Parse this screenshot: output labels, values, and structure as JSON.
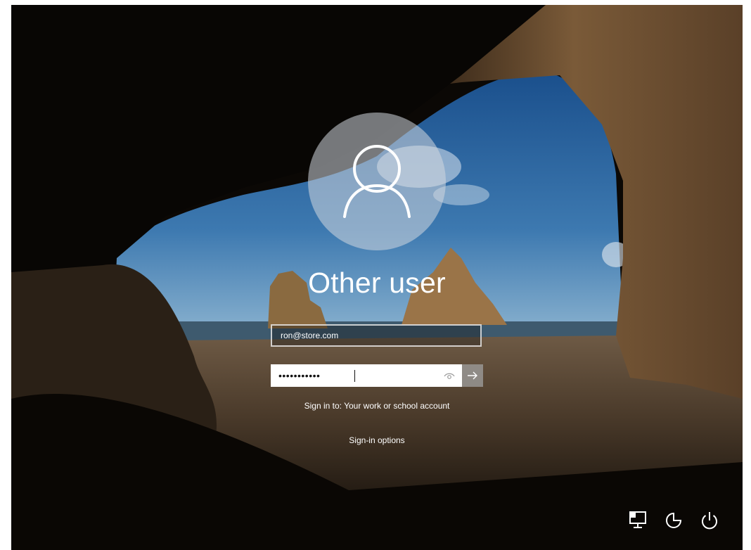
{
  "login": {
    "user_name": "Other user",
    "email_value": "ron@store.com",
    "password_mask": "•••••••••••",
    "sign_in_to": "Sign in to: Your work or school account",
    "sign_in_options": "Sign-in options"
  },
  "icons": {
    "avatar": "person-icon",
    "reveal": "eye-icon",
    "submit": "arrow-right-icon",
    "network": "network-icon",
    "accessibility": "ease-of-access-icon",
    "power": "power-icon"
  },
  "colors": {
    "text": "#ffffff",
    "password_bg": "#ffffff",
    "submit_bg": "#a0a0a0"
  }
}
